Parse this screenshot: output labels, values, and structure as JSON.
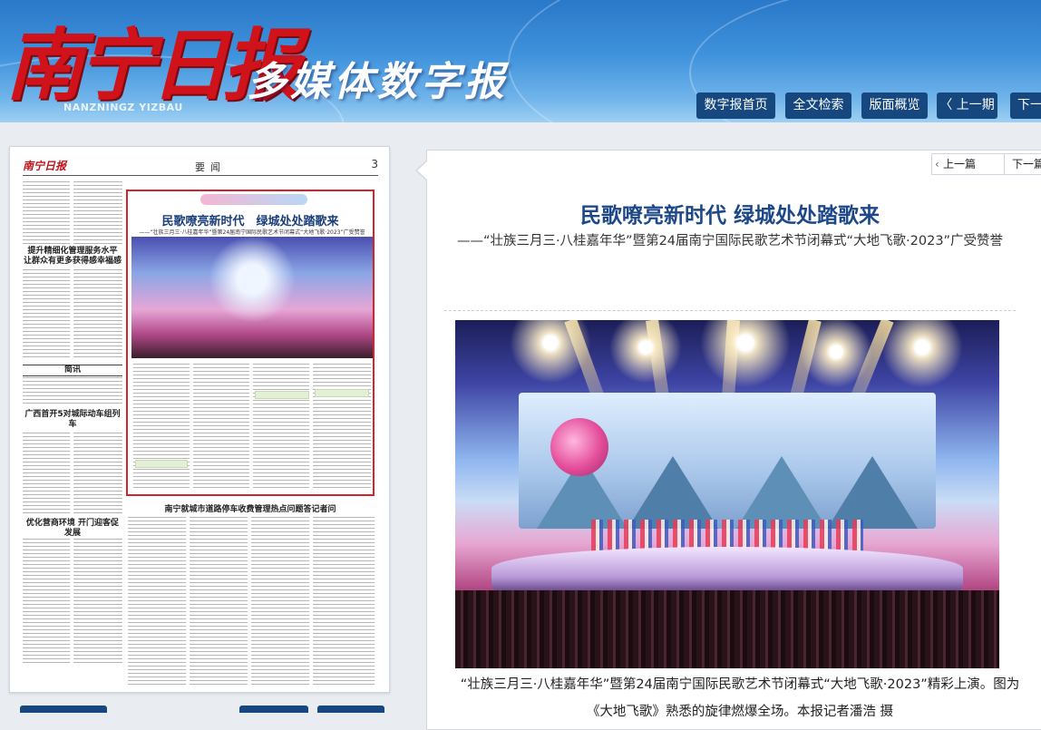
{
  "header": {
    "logo": "南宁日报",
    "logo_pinyin": "NANZNINGZ YIZBAU",
    "subtitle": "多媒体数字报",
    "nav": {
      "home": "数字报首页",
      "search": "全文检索",
      "overview": "版面概览",
      "prev": "〈 上一期",
      "next": "下一"
    }
  },
  "page_preview": {
    "paper_logo": "南宁日报",
    "section": "要闻",
    "page_number": "3",
    "article_title": "民歌嘹亮新时代　绿城处处踏歌来",
    "article_sub": "——“壮族三月三·八桂嘉年华”暨第24届南宁国际民歌艺术节闭幕式“大地飞歌·2023”广受赞誉",
    "headline_1": "提升精细化管理服务水平 让群众有更多获得感幸福感",
    "headline_2": "简讯",
    "headline_3": "广西首开5对城际动车组列车",
    "headline_4": "优化营商环境 开门迎客促发展",
    "bottom_title": "南宁就城市道路停车收费管理热点问题答记者问"
  },
  "reader": {
    "prev": "上一篇",
    "next": "下一篇",
    "title": "民歌嘹亮新时代 绿城处处踏歌来",
    "subtitle": "——“壮族三月三·八桂嘉年华”暨第24届南宁国际民歌艺术节闭幕式“大地飞歌·2023”广受赞誉",
    "caption": "“壮族三月三·八桂嘉年华”暨第24届南宁国际民歌艺术节闭幕式“大地飞歌·2023”精彩上演。图为《大地飞歌》熟悉的旋律燃爆全场。本报记者潘浩 摄"
  },
  "colors": {
    "banner": "#3f92dc",
    "logo_red": "#d0121b",
    "nav_button": "#16477f",
    "title_blue": "#1c4789",
    "highlight_border": "#d6222a"
  }
}
